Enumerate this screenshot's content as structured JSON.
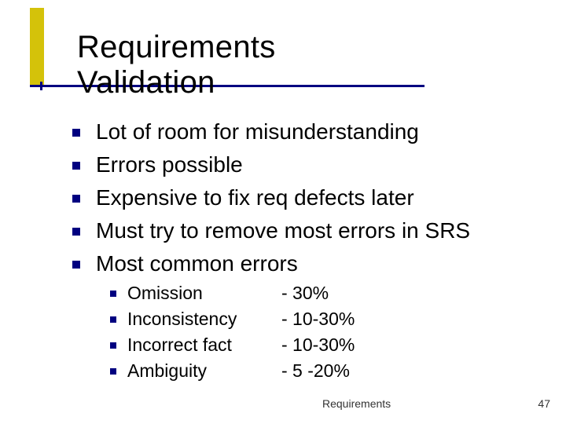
{
  "title": "Requirements Validation",
  "bullets_l1": [
    "Lot of room for misunderstanding",
    "Errors possible",
    "Expensive to fix req defects later",
    "Must try to remove most errors in SRS",
    "Most common errors"
  ],
  "bullets_l2": [
    {
      "label": "Omission",
      "value": "- 30%"
    },
    {
      "label": "Inconsistency",
      "value": "- 10-30%"
    },
    {
      "label": "Incorrect fact",
      "value": "- 10-30%"
    },
    {
      "label": "Ambiguity",
      "value": "-  5 -20%"
    }
  ],
  "footer": {
    "label": "Requirements",
    "page": "47"
  },
  "colors": {
    "accent_bullet": "#000080",
    "accent_bar": "#d4c20a"
  }
}
